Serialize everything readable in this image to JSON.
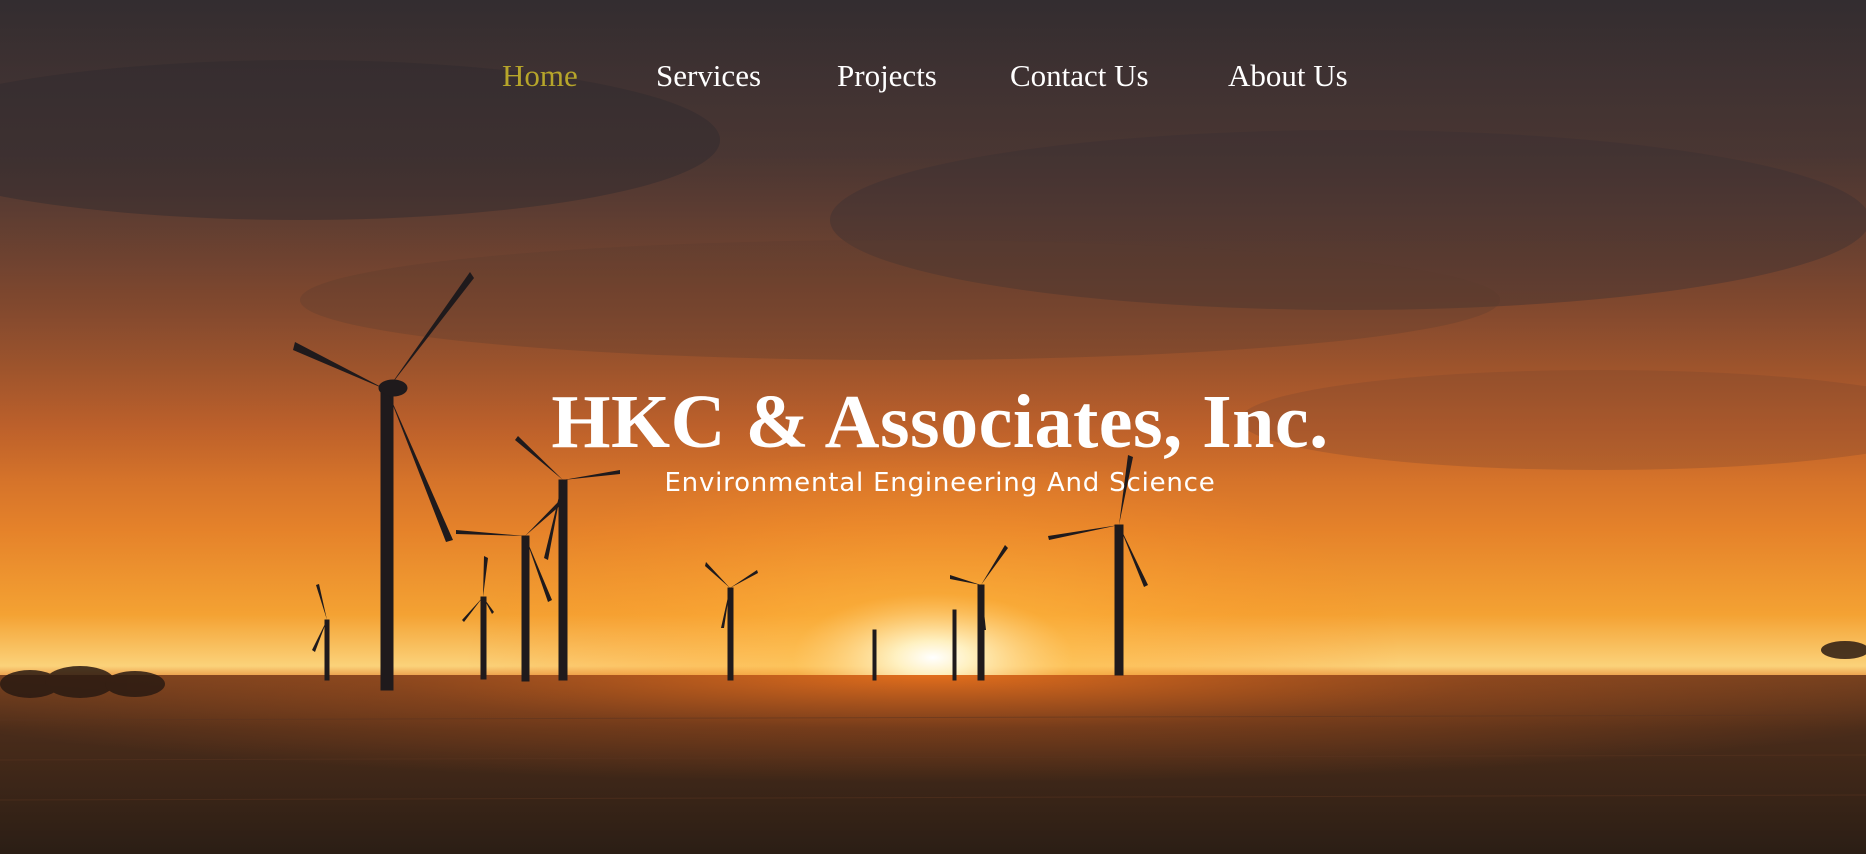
{
  "nav": {
    "items": [
      {
        "label": "Home",
        "active": true
      },
      {
        "label": "Services",
        "active": false
      },
      {
        "label": "Projects",
        "active": false
      },
      {
        "label": "Contact Us",
        "active": false
      },
      {
        "label": "About Us",
        "active": false
      }
    ],
    "active_color": "#b6a52a",
    "text_color": "#ffffff"
  },
  "hero": {
    "title": "HKC & Associates, Inc.",
    "subtitle": "Environmental Engineering And Science",
    "background": "sunset-wind-turbines-field"
  }
}
